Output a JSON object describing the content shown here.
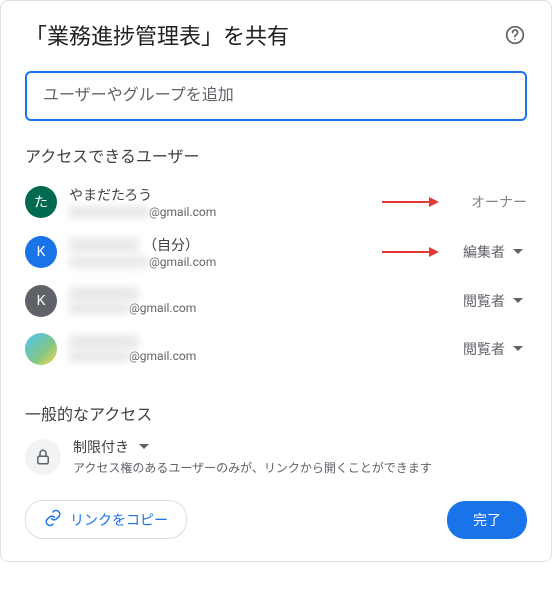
{
  "header": {
    "title": "「業務進捗管理表」を共有"
  },
  "input": {
    "placeholder": "ユーザーやグループを追加"
  },
  "access_section_label": "アクセスできるユーザー",
  "users": [
    {
      "avatar_letter": "た",
      "name": "やまだたろう",
      "email_suffix": "@gmail.com",
      "role": "オーナー",
      "is_owner": true,
      "highlighted": true
    },
    {
      "avatar_letter": "K",
      "name_suffix": "（自分）",
      "email_suffix": "@gmail.com",
      "role": "編集者",
      "is_owner": false,
      "highlighted": true
    },
    {
      "avatar_letter": "K",
      "email_suffix": "@gmail.com",
      "role": "閲覧者",
      "is_owner": false,
      "highlighted": false
    },
    {
      "email_suffix": "@gmail.com",
      "role": "閲覧者",
      "is_owner": false,
      "highlighted": false
    }
  ],
  "general_access": {
    "label": "一般的なアクセス",
    "title": "制限付き",
    "description": "アクセス権のあるユーザーのみが、リンクから開くことができます"
  },
  "footer": {
    "copy_link": "リンクをコピー",
    "done": "完了"
  }
}
